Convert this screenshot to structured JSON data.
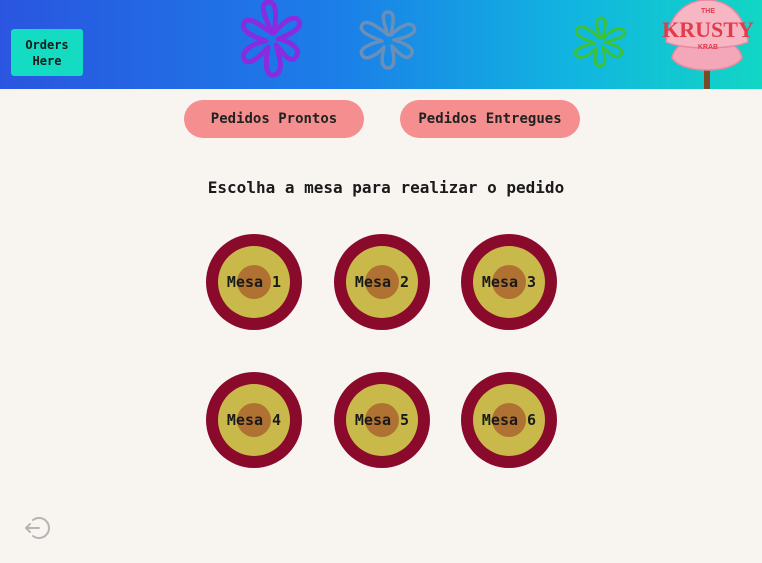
{
  "header": {
    "orders_button_label": "Orders\nHere",
    "logo": {
      "top_small": "THE",
      "name": "KRUSTY",
      "bottom_small": "KRAB"
    }
  },
  "nav": {
    "ready_orders_label": "Pedidos Prontos",
    "delivered_orders_label": "Pedidos Entregues"
  },
  "main": {
    "title": "Escolha a mesa para realizar o pedido",
    "tables": [
      {
        "label": "Mesa 1"
      },
      {
        "label": "Mesa 2"
      },
      {
        "label": "Mesa 3"
      },
      {
        "label": "Mesa 4"
      },
      {
        "label": "Mesa 5"
      },
      {
        "label": "Mesa 6"
      }
    ]
  },
  "footer": {
    "logout_icon": "logout-icon"
  },
  "colors": {
    "header_start": "#2a55e0",
    "header_end": "#12d6c4",
    "orders_button": "#13dcc3",
    "pill_button": "#f58f8f",
    "table_outer": "#8a0a2c",
    "table_ring": "#c9b94a",
    "table_center": "#b07232",
    "background": "#f8f5f1"
  }
}
